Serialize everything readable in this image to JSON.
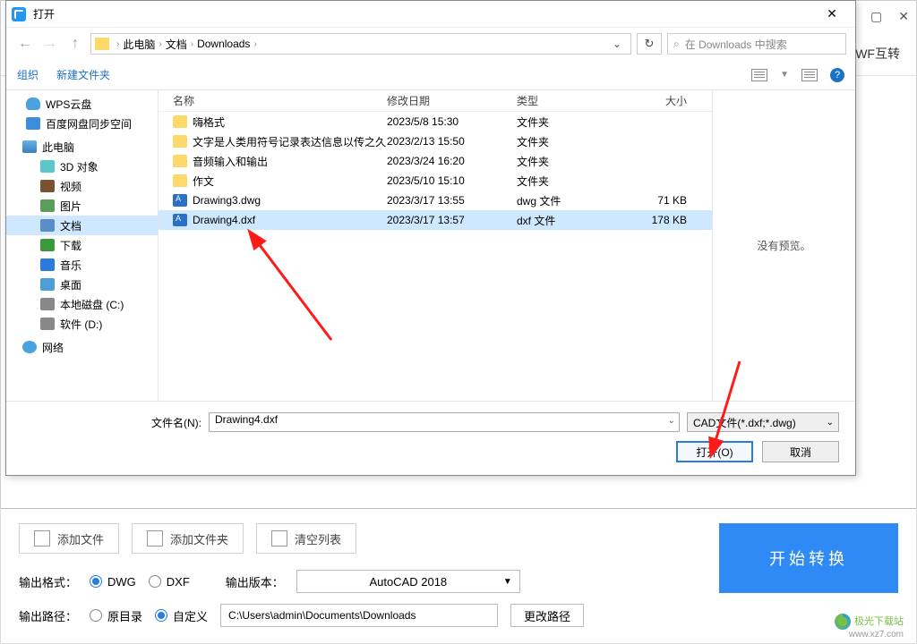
{
  "outer": {
    "tab_label": "DWF互转"
  },
  "dialog": {
    "title": "打开",
    "breadcrumb": [
      "此电脑",
      "文档",
      "Downloads"
    ],
    "search_placeholder": "在 Downloads 中搜索",
    "organize": "组织",
    "new_folder": "新建文件夹",
    "sidebar": [
      {
        "label": "WPS云盘",
        "icon": "ic-cloud",
        "indent": 0
      },
      {
        "label": "百度网盘同步空间",
        "icon": "ic-baidu",
        "indent": 0
      },
      {
        "label": "此电脑",
        "icon": "ic-pc",
        "indent": 0,
        "header": true
      },
      {
        "label": "3D 对象",
        "icon": "ic-3d",
        "indent": 1
      },
      {
        "label": "视频",
        "icon": "ic-video",
        "indent": 1
      },
      {
        "label": "图片",
        "icon": "ic-pic",
        "indent": 1
      },
      {
        "label": "文档",
        "icon": "ic-doc",
        "indent": 1,
        "selected": true
      },
      {
        "label": "下载",
        "icon": "ic-down",
        "indent": 1
      },
      {
        "label": "音乐",
        "icon": "ic-music",
        "indent": 1
      },
      {
        "label": "桌面",
        "icon": "ic-desktop",
        "indent": 1
      },
      {
        "label": "本地磁盘 (C:)",
        "icon": "ic-drive",
        "indent": 1
      },
      {
        "label": "软件 (D:)",
        "icon": "ic-drive",
        "indent": 1
      },
      {
        "label": "网络",
        "icon": "ic-net",
        "indent": 0,
        "header": true
      }
    ],
    "columns": {
      "name": "名称",
      "date": "修改日期",
      "type": "类型",
      "size": "大小"
    },
    "files": [
      {
        "name": "嗨格式",
        "date": "2023/5/8 15:30",
        "type": "文件夹",
        "size": "",
        "icon": "ic-folder"
      },
      {
        "name": "文字是人类用符号记录表达信息以传之久...",
        "date": "2023/2/13 15:50",
        "type": "文件夹",
        "size": "",
        "icon": "ic-folder"
      },
      {
        "name": "音频输入和输出",
        "date": "2023/3/24 16:20",
        "type": "文件夹",
        "size": "",
        "icon": "ic-folder"
      },
      {
        "name": "作文",
        "date": "2023/5/10 15:10",
        "type": "文件夹",
        "size": "",
        "icon": "ic-folder"
      },
      {
        "name": "Drawing3.dwg",
        "date": "2023/3/17 13:55",
        "type": "dwg 文件",
        "size": "71 KB",
        "icon": "ic-dwg"
      },
      {
        "name": "Drawing4.dxf",
        "date": "2023/3/17 13:57",
        "type": "dxf 文件",
        "size": "178 KB",
        "icon": "ic-dwg",
        "selected": true
      }
    ],
    "preview_text": "没有预览。",
    "filename_label": "文件名(N):",
    "filename_value": "Drawing4.dxf",
    "filetype_value": "CAD文件(*.dxf;*.dwg)",
    "open_btn": "打开(O)",
    "cancel_btn": "取消"
  },
  "app": {
    "add_file": "添加文件",
    "add_folder": "添加文件夹",
    "clear_list": "清空列表",
    "out_format_label": "输出格式：",
    "fmt_dwg": "DWG",
    "fmt_dxf": "DXF",
    "out_version_label": "输出版本：",
    "version_value": "AutoCAD 2018",
    "out_path_label": "输出路径：",
    "path_original": "原目录",
    "path_custom": "自定义",
    "path_value": "C:\\Users\\admin\\Documents\\Downloads",
    "change_path": "更改路径",
    "start_btn": "开始转换",
    "watermark1": "极光下载站",
    "watermark2": "www.xz7.com"
  }
}
